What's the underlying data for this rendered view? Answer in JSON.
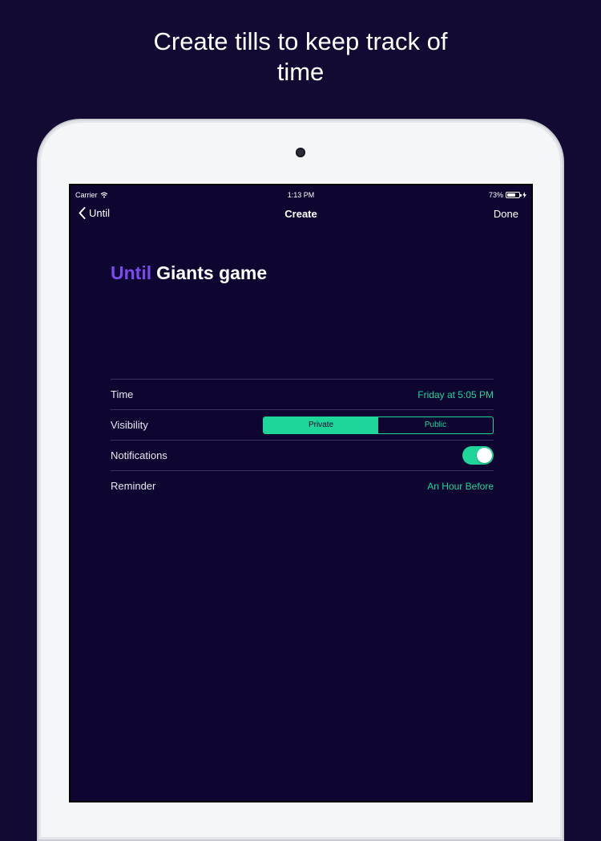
{
  "headline": "Create tills to keep track of time",
  "status_bar": {
    "carrier": "Carrier",
    "time": "1:13 PM",
    "battery": "73%",
    "battery_level": 0.73
  },
  "nav": {
    "back_label": "Until",
    "title": "Create",
    "done_label": "Done"
  },
  "till": {
    "prefix": "Until",
    "name": "Giants game"
  },
  "settings": {
    "time_label": "Time",
    "time_value": "Friday at 5:05 PM",
    "visibility_label": "Visibility",
    "visibility_options": [
      "Private",
      "Public"
    ],
    "visibility_selected": "Private",
    "notifications_label": "Notifications",
    "notifications_on": true,
    "reminder_label": "Reminder",
    "reminder_value": "An Hour Before"
  },
  "colors": {
    "background": "#120a33",
    "screen": "#0e0630",
    "accent_green": "#1ed69a",
    "accent_purple": "#7a4cf0"
  },
  "icons": [
    "wifi-icon",
    "battery-icon",
    "charging-icon",
    "chevron-left-icon",
    "camera"
  ]
}
